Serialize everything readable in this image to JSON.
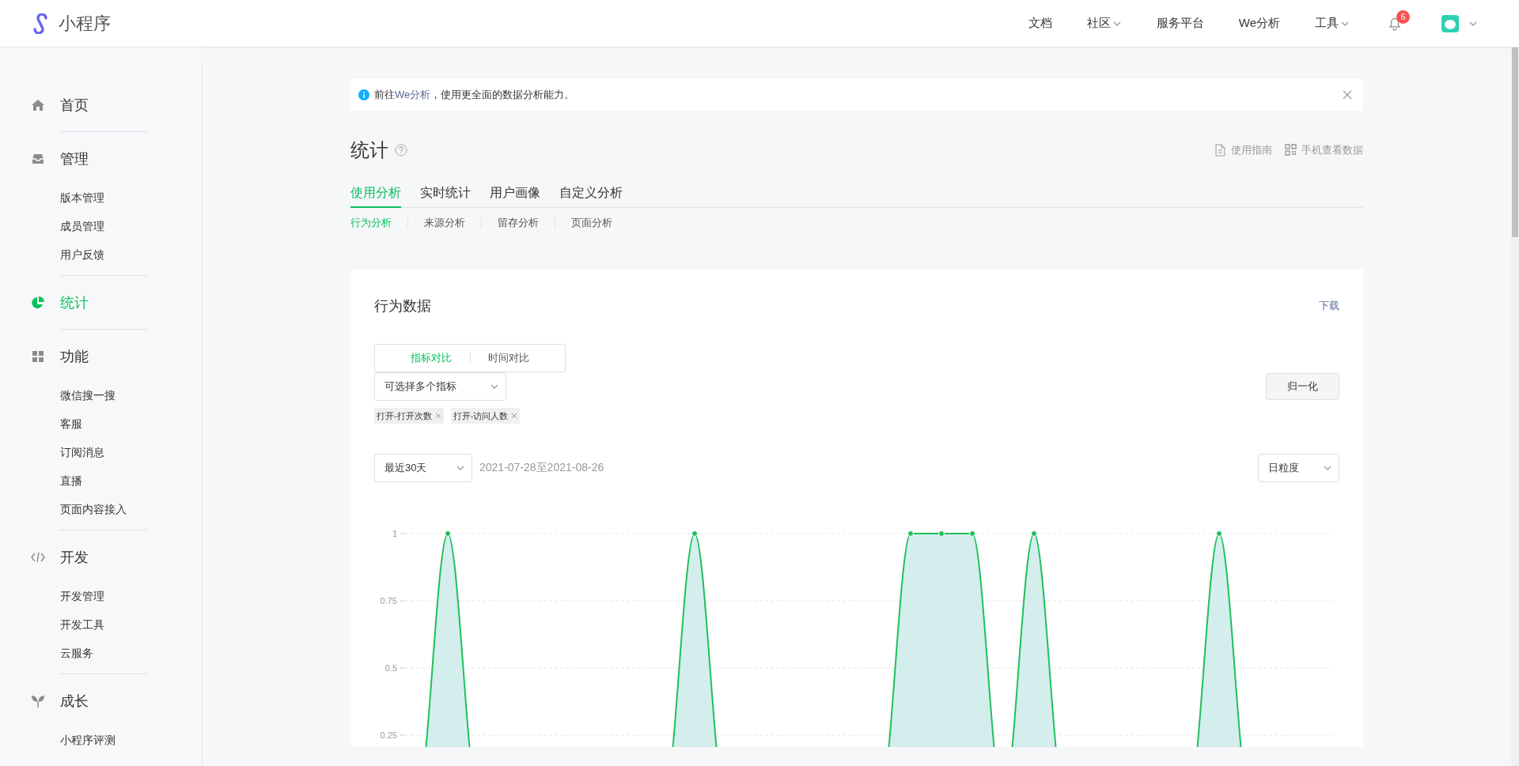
{
  "topbar": {
    "logo_text": "小程序",
    "nav": [
      {
        "label": "文档",
        "dropdown": false
      },
      {
        "label": "社区",
        "dropdown": true
      },
      {
        "label": "服务平台",
        "dropdown": false
      },
      {
        "label": "We分析",
        "dropdown": false
      },
      {
        "label": "工具",
        "dropdown": true
      }
    ],
    "notification_count": "6"
  },
  "sidebar": {
    "sections": [
      {
        "label": "首页",
        "selected": false
      },
      {
        "label": "管理",
        "selected": false,
        "children": [
          {
            "label": "版本管理",
            "selected": false
          },
          {
            "label": "成员管理",
            "selected": false
          },
          {
            "label": "用户反馈",
            "selected": false
          }
        ]
      },
      {
        "label": "统计",
        "selected": true
      },
      {
        "label": "功能",
        "selected": false,
        "children": [
          {
            "label": "微信搜一搜",
            "selected": false
          },
          {
            "label": "客服",
            "selected": false
          },
          {
            "label": "订阅消息",
            "selected": false
          },
          {
            "label": "直播",
            "selected": false
          },
          {
            "label": "页面内容接入",
            "selected": false
          }
        ]
      },
      {
        "label": "开发",
        "selected": false,
        "children": [
          {
            "label": "开发管理",
            "selected": false
          },
          {
            "label": "开发工具",
            "selected": false
          },
          {
            "label": "云服务",
            "selected": false
          }
        ]
      },
      {
        "label": "成长",
        "selected": false,
        "children": [
          {
            "label": "小程序评测",
            "selected": false
          }
        ]
      }
    ]
  },
  "notice": {
    "before": "前往",
    "link": "We分析",
    "after": "，使用更全面的数据分析能力。"
  },
  "page_title": "统计",
  "header_links": [
    {
      "label": "使用指南"
    },
    {
      "label": "手机查看数据"
    }
  ],
  "tabs": [
    {
      "label": "使用分析",
      "selected": true
    },
    {
      "label": "实时统计",
      "selected": false
    },
    {
      "label": "用户画像",
      "selected": false
    },
    {
      "label": "自定义分析",
      "selected": false
    }
  ],
  "subtabs": [
    {
      "label": "行为分析",
      "selected": true
    },
    {
      "label": "来源分析",
      "selected": false
    },
    {
      "label": "留存分析",
      "selected": false
    },
    {
      "label": "页面分析",
      "selected": false
    }
  ],
  "card": {
    "title": "行为数据",
    "download": "下载",
    "compare_modes": [
      {
        "label": "指标对比",
        "selected": true
      },
      {
        "label": "时间对比",
        "selected": false
      }
    ],
    "metric_select": "可选择多个指标",
    "tags": [
      "打开-打开次数",
      "打开-访问人数"
    ],
    "normalize_button": "归一化",
    "range_select": "最近30天",
    "date_range": "2021-07-28至2021-08-26",
    "granularity_select": "日粒度",
    "chart_data": {
      "type": "area",
      "grid": true,
      "ylim": [
        0,
        1
      ],
      "yticks": [
        0.25,
        0.5,
        0.75,
        {
          "value": 1,
          "label": "1"
        }
      ],
      "series": [
        {
          "color": "#1fbf5c",
          "values": [
            0,
            1,
            0,
            0,
            0,
            0,
            0,
            0,
            0,
            1,
            0,
            0,
            0,
            0,
            0,
            0,
            1,
            1,
            1,
            0,
            1,
            0,
            0,
            0,
            0,
            0,
            1,
            0,
            0,
            0
          ]
        }
      ]
    }
  }
}
